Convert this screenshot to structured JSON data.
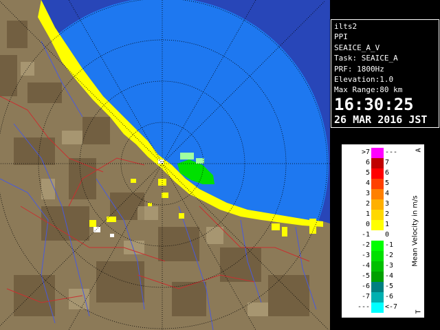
{
  "info": {
    "site": "ilts2",
    "mode": "PPI",
    "volume": "SEAICE_A_V",
    "task": "Task: SEAICE_A",
    "prf": "PRF: 1800Hz",
    "elevation": "Elevation:1.0",
    "max_range": "Max Range:80 km",
    "time": "16:30:25",
    "date": "26 MAR 2016 JST"
  },
  "legend": {
    "title": "Mean Velocity in m/s",
    "top_marker": "A",
    "bottom_marker": "T",
    "rows": [
      {
        "left": ">7",
        "right": "---",
        "color": "#ff00ff"
      },
      {
        "left": "6",
        "right": "7",
        "color": "#c00000"
      },
      {
        "left": "5",
        "right": "6",
        "color": "#ff0000"
      },
      {
        "left": "4",
        "right": "5",
        "color": "#ff4000"
      },
      {
        "left": "3",
        "right": "4",
        "color": "#ff8000"
      },
      {
        "left": "2",
        "right": "3",
        "color": "#ffb000"
      },
      {
        "left": "1",
        "right": "2",
        "color": "#ffd800"
      },
      {
        "left": "0",
        "right": "1",
        "color": "#ffff00"
      },
      {
        "left": "-1",
        "right": "0",
        "color": "#ffffff"
      },
      {
        "left": "-2",
        "right": "-1",
        "color": "#00ff00"
      },
      {
        "left": "-3",
        "right": "-2",
        "color": "#00e000"
      },
      {
        "left": "-4",
        "right": "-3",
        "color": "#00c000"
      },
      {
        "left": "-5",
        "right": "-4",
        "color": "#00a000"
      },
      {
        "left": "-6",
        "right": "-5",
        "color": "#008080"
      },
      {
        "left": "-7",
        "right": "-6",
        "color": "#00b0b0"
      },
      {
        "left": "---",
        "right": "<-7",
        "color": "#00ffff"
      }
    ]
  },
  "colors": {
    "sea": "#1e78f0",
    "outer_sea": "#2846b8",
    "land": "#8c7856",
    "coast_echo": "#ffff00",
    "grid": "#000000"
  }
}
